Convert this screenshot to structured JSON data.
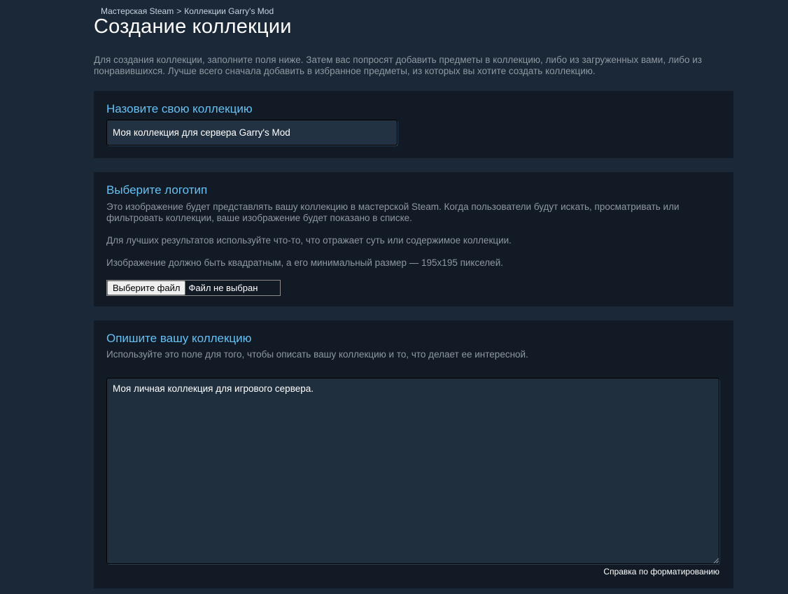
{
  "breadcrumb": {
    "items": [
      "Мастерская Steam",
      "Коллекции Garry's Mod"
    ],
    "separator": ">"
  },
  "page_title": "Создание коллекции",
  "intro_text": "Для создания коллекции, заполните поля ниже. Затем вас попросят добавить предметы в коллекцию, либо из загруженных вами, либо из понравившихся. Лучше всего сначала добавить в избранное предметы, из которых вы хотите создать коллекцию.",
  "name_section": {
    "title": "Назовите свою коллекцию",
    "input_value": "Моя коллекция для сервера Garry's Mod"
  },
  "logo_section": {
    "title": "Выберите логотип",
    "description": "Это изображение будет представлять вашу коллекцию в мастерской Steam. Когда пользователи будут искать, просматривать или фильтровать коллекции, ваше изображение будет показано в списке.",
    "hint": "Для лучших результатов используйте что-то, что отражает суть или содержимое коллекции.",
    "size_requirement": "Изображение должно быть квадратным, а его минимальный размер — 195x195 пикселей.",
    "file_button_label": "Выберите файл",
    "file_status": "Файл не выбран"
  },
  "description_section": {
    "title": "Опишите вашу коллекцию",
    "hint": "Используйте это поле для того, чтобы описать вашу коллекцию и то, что делает ее интересной.",
    "textarea_value": "Моя личная коллекция для игрового сервера.",
    "format_help_link": "Справка по форматированию"
  },
  "colors": {
    "background": "#1b2838",
    "panel": "#111a25",
    "accent_title": "#66c0f4",
    "body_text": "#8f98a0"
  }
}
